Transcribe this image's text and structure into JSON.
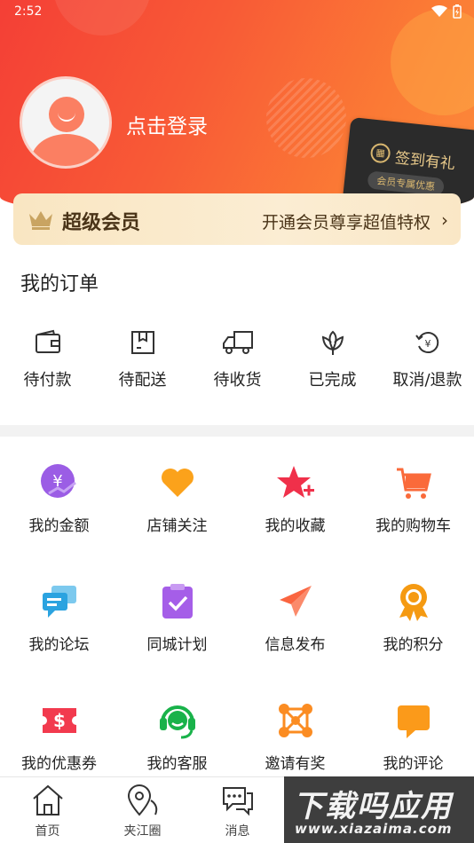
{
  "status_bar": {
    "time": "2:52"
  },
  "profile": {
    "login_text": "点击登录"
  },
  "signin_card": {
    "title": "签到有礼",
    "subtitle": "会员专属优惠"
  },
  "vip": {
    "title": "超级会员",
    "promo": "开通会员尊享超值特权",
    "chevron": "›"
  },
  "orders": {
    "title": "我的订单",
    "items": [
      {
        "label": "待付款",
        "icon": "wallet-icon"
      },
      {
        "label": "待配送",
        "icon": "package-icon"
      },
      {
        "label": "待收货",
        "icon": "truck-icon"
      },
      {
        "label": "已完成",
        "icon": "lotus-icon"
      },
      {
        "label": "取消/退款",
        "icon": "refund-icon"
      }
    ]
  },
  "grid": [
    {
      "label": "我的金额",
      "icon": "balance-icon",
      "color": "#9b5de5"
    },
    {
      "label": "店铺关注",
      "icon": "heart-icon",
      "color": "#fba21b"
    },
    {
      "label": "我的收藏",
      "icon": "star-plus-icon",
      "color": "#f0304a"
    },
    {
      "label": "我的购物车",
      "icon": "cart-icon",
      "color": "#fa6a3a"
    },
    {
      "label": "我的论坛",
      "icon": "forum-icon",
      "color": "#2ba3e0"
    },
    {
      "label": "同城计划",
      "icon": "clipboard-check-icon",
      "color": "#a55ee8"
    },
    {
      "label": "信息发布",
      "icon": "paper-plane-icon",
      "color": "#fa6540"
    },
    {
      "label": "我的积分",
      "icon": "medal-icon",
      "color": "#f59a12"
    },
    {
      "label": "我的优惠券",
      "icon": "coupon-icon",
      "color": "#f23a4e"
    },
    {
      "label": "我的客服",
      "icon": "headset-icon",
      "color": "#19b24a"
    },
    {
      "label": "邀请有奖",
      "icon": "network-icon",
      "color": "#fb8c22"
    },
    {
      "label": "我的评论",
      "icon": "comment-icon",
      "color": "#fb9a1a"
    }
  ],
  "bottom_nav": [
    {
      "label": "首页",
      "icon": "home-icon"
    },
    {
      "label": "夹江圈",
      "icon": "location-icon"
    },
    {
      "label": "消息",
      "icon": "message-icon"
    }
  ],
  "watermark": {
    "title": "下载吗应用",
    "url": "www.xiazaima.com"
  }
}
